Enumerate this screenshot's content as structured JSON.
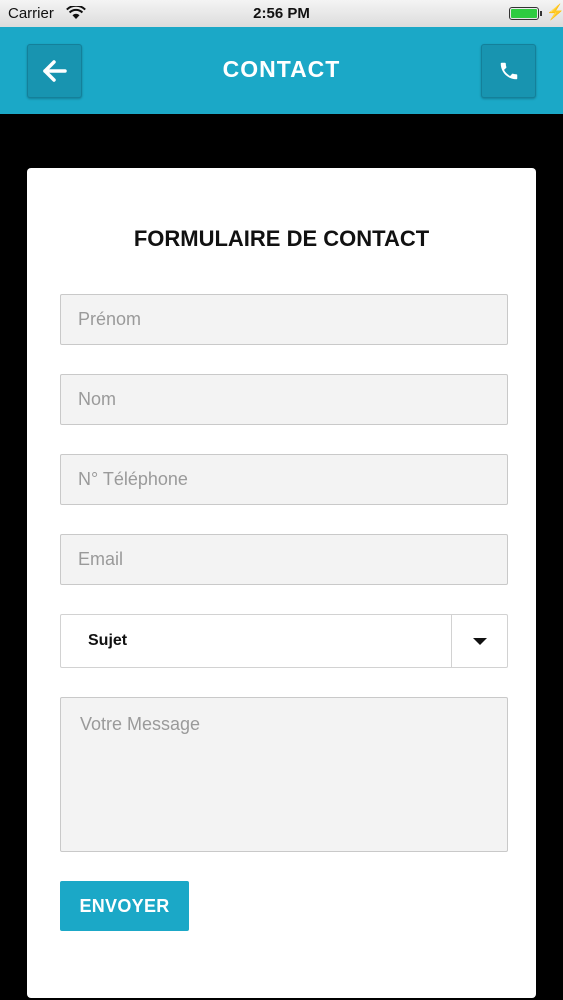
{
  "status_bar": {
    "carrier": "Carrier",
    "time": "2:56 PM",
    "battery_level": 1.0
  },
  "header": {
    "title": "CONTACT",
    "back_icon": "arrow-left-icon",
    "phone_icon": "phone-icon",
    "color": "#1ba8c7"
  },
  "form": {
    "title": "FORMULAIRE DE CONTACT",
    "fields": {
      "prenom_placeholder": "Prénom",
      "nom_placeholder": "Nom",
      "tel_placeholder": "N° Téléphone",
      "email_placeholder": "Email",
      "message_placeholder": "Votre Message"
    },
    "subject": {
      "selected": "Sujet"
    },
    "submit_label": "ENVOYER"
  }
}
